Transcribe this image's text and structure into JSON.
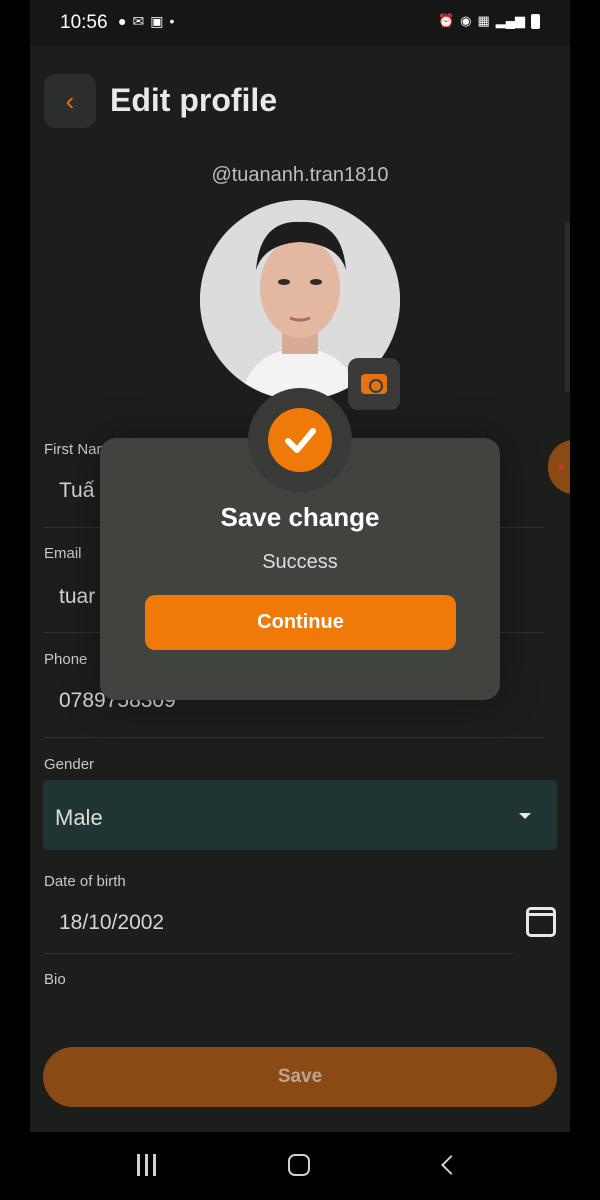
{
  "status_bar": {
    "time": "10:56"
  },
  "header": {
    "title": "Edit profile"
  },
  "profile": {
    "username": "@tuananh.tran1810"
  },
  "fields": {
    "first_name": {
      "label": "First Nam",
      "value": "Tuấ"
    },
    "email": {
      "label": "Email",
      "value": "tuar"
    },
    "phone": {
      "label": "Phone",
      "value": "0789758309"
    },
    "gender": {
      "label": "Gender",
      "value": "Male"
    },
    "dob": {
      "label": "Date of birth",
      "value": "18/10/2002"
    },
    "bio": {
      "label": "Bio"
    }
  },
  "save_button": {
    "label": "Save"
  },
  "dialog": {
    "title": "Save change",
    "subtitle": "Success",
    "continue_label": "Continue"
  },
  "colors": {
    "accent": "#ef7a07",
    "background": "#1c1e1c",
    "dialog": "#41433f"
  }
}
